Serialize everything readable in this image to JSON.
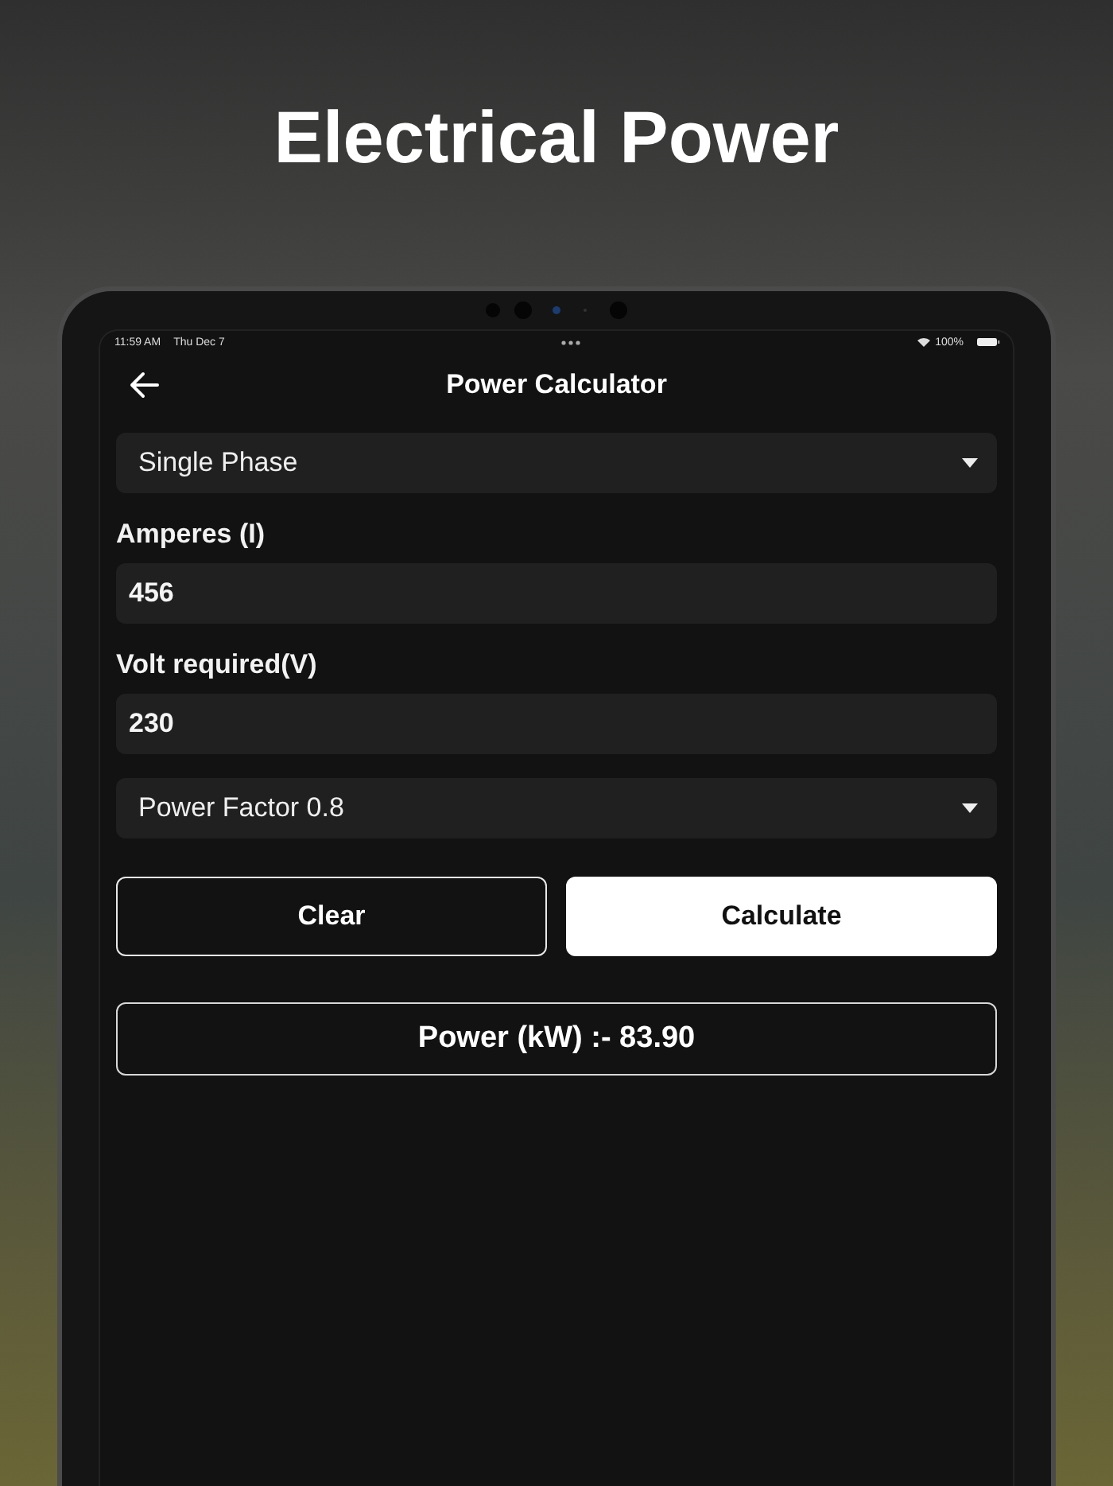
{
  "headline": "Electrical Power",
  "status_bar": {
    "time": "11:59 AM",
    "date": "Thu Dec 7",
    "battery": "100%"
  },
  "app_bar": {
    "title": "Power Calculator"
  },
  "form": [
    {
      "kind": "dropdown",
      "value": "Single Phase"
    },
    {
      "kind": "field",
      "label": "Amperes (I)",
      "value": "456"
    },
    {
      "kind": "field",
      "label": "Volt required(V)",
      "value": "230"
    },
    {
      "kind": "dropdown",
      "value": "Power Factor 0.8"
    }
  ],
  "buttons": [
    {
      "label": "Clear",
      "kind": "outline"
    },
    {
      "label": "Calculate",
      "kind": "filled"
    }
  ],
  "result": "Power (kW) :- 83.90"
}
